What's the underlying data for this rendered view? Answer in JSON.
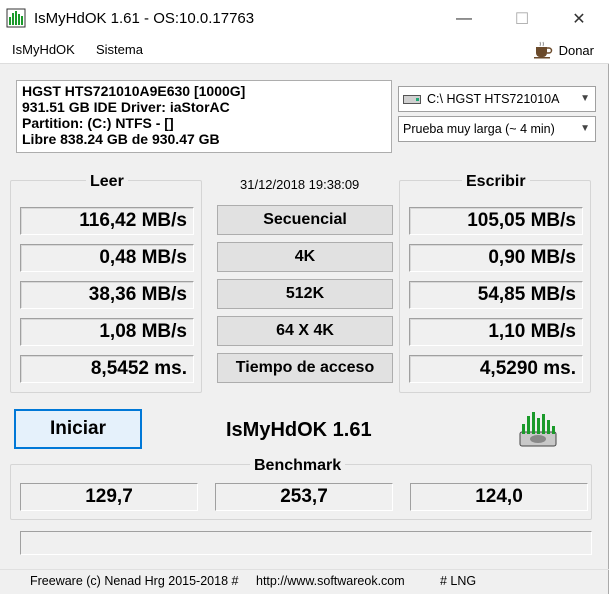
{
  "window": {
    "title": "IsMyHdOK 1.61 - OS:10.0.17763",
    "minimize": "—",
    "maximize": "☐",
    "close": "✕"
  },
  "menu": {
    "items": [
      "IsMyHdOK",
      "Sistema"
    ],
    "donate": "Donar"
  },
  "drive_info": {
    "lines": [
      "HGST HTS721010A9E630 [1000G]",
      "931.51 GB  IDE Driver: iaStorAC",
      "Partition: (C:) NTFS - []",
      "Libre  838.24 GB de  930.47 GB"
    ]
  },
  "selectors": {
    "drive": "C:\\ HGST HTS721010A",
    "test": "Prueba muy larga (~ 4 min)"
  },
  "results": {
    "read_label": "Leer",
    "write_label": "Escribir",
    "datetime": "31/12/2018 19:38:09",
    "rows": [
      {
        "label": "Secuencial",
        "read": "116,42 MB/s",
        "write": "105,05 MB/s"
      },
      {
        "label": "4K",
        "read": "0,48 MB/s",
        "write": "0,90 MB/s"
      },
      {
        "label": "512K",
        "read": "38,36 MB/s",
        "write": "54,85 MB/s"
      },
      {
        "label": "64 X 4K",
        "read": "1,08 MB/s",
        "write": "1,10 MB/s"
      },
      {
        "label": "Tiempo de acceso",
        "read": "8,5452 ms.",
        "write": "4,5290 ms."
      }
    ]
  },
  "actions": {
    "start": "Iniciar",
    "app_name": "IsMyHdOK 1.61"
  },
  "benchmark": {
    "label": "Benchmark",
    "values": [
      "129,7",
      "253,7",
      "124,0"
    ]
  },
  "status": {
    "freeware": "Freeware (c) Nenad Hrg 2015-2018 #",
    "url": "http://www.softwareok.com",
    "lng": "# LNG"
  },
  "colors": {
    "accent": "#0078d7",
    "logo_green": "#1a9a2a"
  }
}
